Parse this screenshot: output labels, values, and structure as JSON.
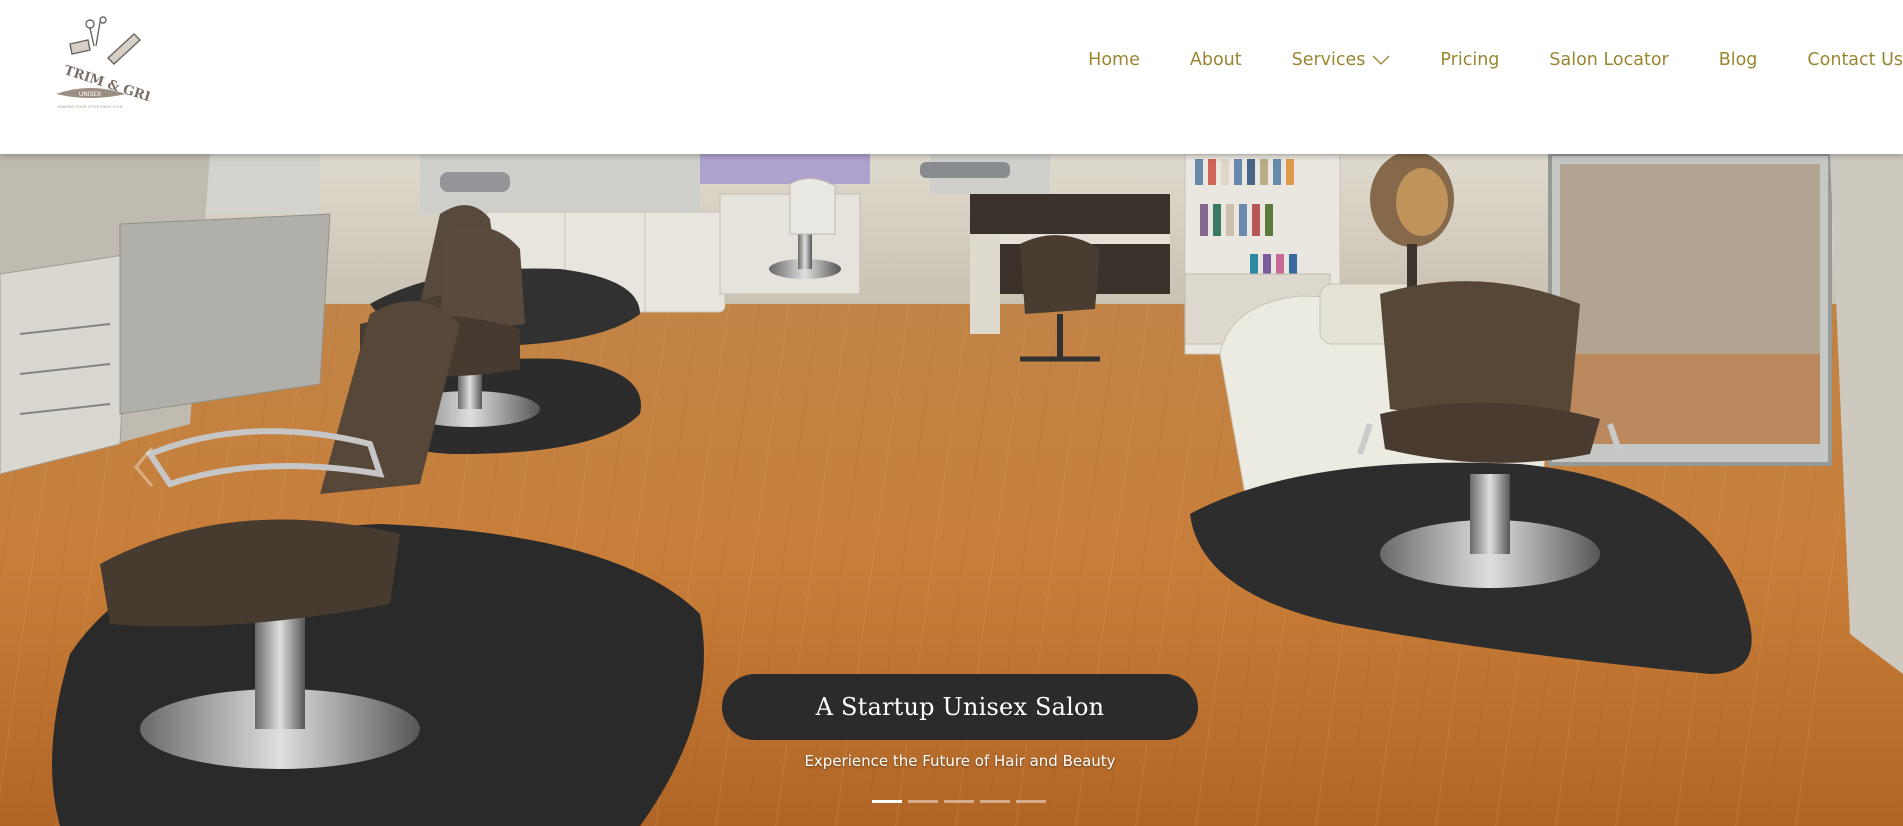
{
  "brand": {
    "name": "TRIM & GRIN",
    "subtitle": "UNISEX",
    "tagline": "SHAPING YOUR STYLE SINCE 2016"
  },
  "nav": {
    "items": [
      {
        "label": "Home"
      },
      {
        "label": "About"
      },
      {
        "label": "Services",
        "has_dropdown": true
      },
      {
        "label": "Pricing"
      },
      {
        "label": "Salon Locator"
      },
      {
        "label": "Blog"
      },
      {
        "label": "Contact Us"
      }
    ]
  },
  "hero": {
    "title": "A Startup Unisex Salon",
    "subtitle": "Experience the Future of Hair and Beauty",
    "slide_count": 5,
    "active_slide": 1
  },
  "colors": {
    "nav_text": "#9a8631",
    "caption_bg": "#2b2b2b",
    "floor": "#c77a33"
  },
  "icons": {
    "services_dropdown": "chevron-down-icon",
    "carousel_prev": "chevron-left-icon"
  }
}
